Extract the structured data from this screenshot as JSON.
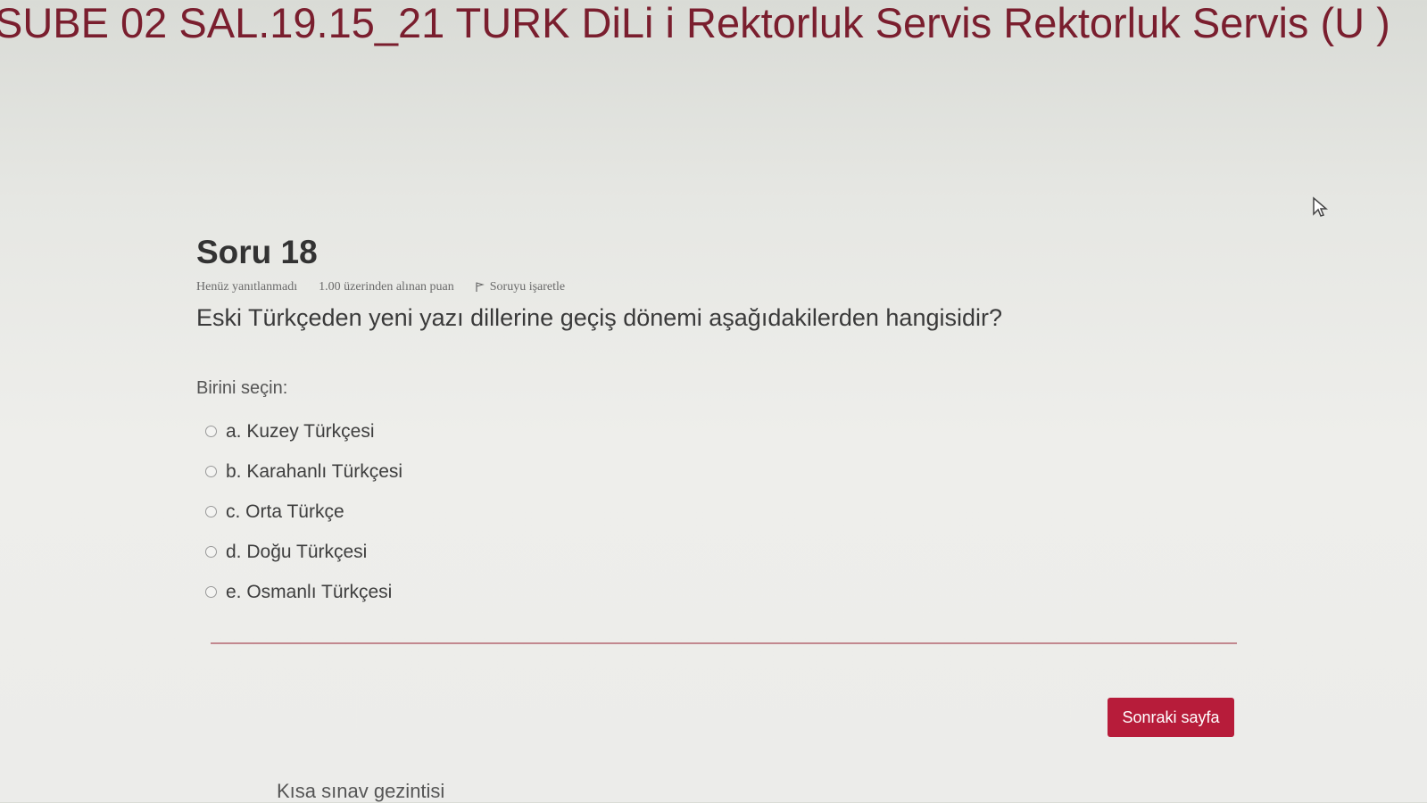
{
  "header": {
    "course_title": "SUBE 02 SAL.19.15_21 TURK DiLi i Rektorluk Servis Rektorluk Servis (U )"
  },
  "question": {
    "title": "Soru 18",
    "status": "Henüz yanıtlanmadı",
    "points": "1.00 üzerinden alınan puan",
    "flag_label": "Soruyu işaretle",
    "text": "Eski Türkçeden yeni yazı dillerine geçiş dönemi aşağıdakilerden hangisidir?",
    "prompt": "Birini seçin:",
    "options": [
      "a. Kuzey Türkçesi",
      "b. Karahanlı Türkçesi",
      "c. Orta Türkçe",
      "d. Doğu Türkçesi",
      "e. Osmanlı Türkçesi"
    ]
  },
  "footer": {
    "next_label": "Sonraki sayfa",
    "nav_label": "Kısa sınav gezintisi"
  },
  "colors": {
    "brand": "#b71c3a",
    "title": "#7a1e2e"
  },
  "icons": [
    "flag-icon",
    "mouse-cursor-icon"
  ]
}
